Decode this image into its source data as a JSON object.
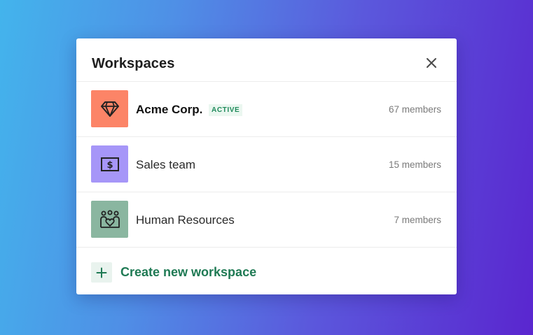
{
  "dialog": {
    "title": "Workspaces",
    "close_icon": "close-icon"
  },
  "workspaces": [
    {
      "name": "Acme Corp.",
      "badge": "ACTIVE",
      "members": "67 members",
      "icon": "diamond-icon",
      "color": "#fc8467"
    },
    {
      "name": "Sales team",
      "badge": "",
      "members": "15 members",
      "icon": "dollar-bill-icon",
      "color": "#a696f8"
    },
    {
      "name": "Human Resources",
      "badge": "",
      "members": "7 members",
      "icon": "people-heart-icon",
      "color": "#8ab6a0"
    }
  ],
  "create": {
    "label": "Create new workspace",
    "icon": "plus-icon"
  },
  "colors": {
    "accent_green": "#1f7a54",
    "badge_green": "#1f8a5b"
  }
}
